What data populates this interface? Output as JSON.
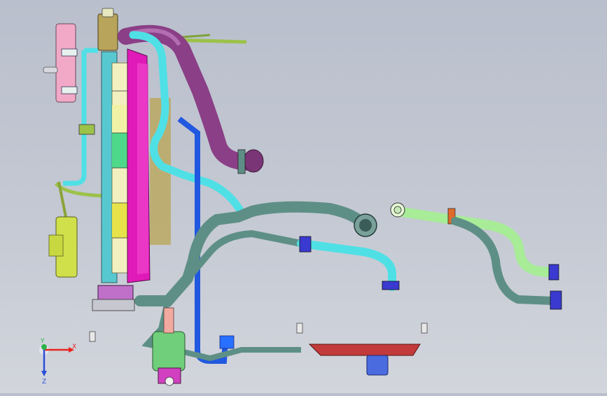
{
  "viewport": {
    "background_top": "#b9bfcc",
    "background_bottom": "#d2d5dc"
  },
  "axis_triad": {
    "x_label": "X",
    "y_label": "Y",
    "z_label": "Z",
    "x_color": "#e8251f",
    "y_color": "#2bb34a",
    "z_color": "#2a4fd8"
  },
  "model": {
    "colors": {
      "radiator_frame": "#58c8d0",
      "fan_shroud": "#e01ab8",
      "purple_hose": "#8a3f86",
      "teal_pipe": "#5e8f86",
      "cyan_pipe": "#4fe0e6",
      "blue_pipe": "#2158e0",
      "green_hose": "#a8ec98",
      "yellow_tank": "#cfe04a",
      "pink_tank": "#f1a9c7",
      "olive_pipe": "#9cc24a",
      "red_pan": "#c23a3a",
      "clamp": "#3a3ad0"
    }
  }
}
